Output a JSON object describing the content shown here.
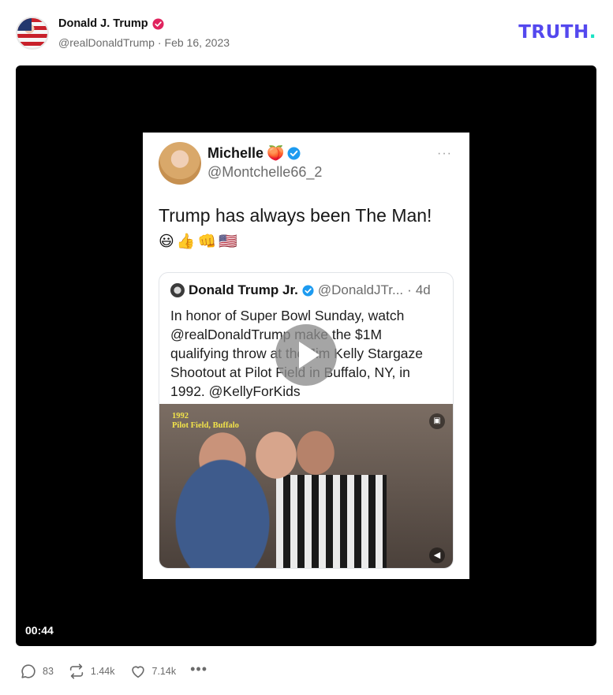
{
  "post": {
    "author_name": "Donald J. Trump",
    "handle": "@realDonaldTrump",
    "separator": "·",
    "date": "Feb 16, 2023"
  },
  "brand": {
    "wordmark": "TRUTH",
    "dot": ".",
    "colors": {
      "text": "#5448ee",
      "dot": "#17e3c4"
    }
  },
  "video": {
    "duration": "00:44",
    "embedded_tweet": {
      "author_name": "Michelle",
      "author_emoji": "🍑",
      "handle": "@Montchelle66_2",
      "more": "···",
      "text": "Trump has always been The Man!",
      "emojis": "😃👍👊🇺🇸",
      "quoted": {
        "author_name": "Donald Trump Jr.",
        "handle": "@DonaldJTr...",
        "separator": "·",
        "age": "4d",
        "text": "In honor of Super Bowl Sunday, watch @realDonaldTrump make the $1M qualifying throw at the Jim Kelly Stargaze Shootout at Pilot Field in Buffalo, NY, in 1992. @KellyForKids",
        "photo_caption_line1": "1992",
        "photo_caption_line2": "Pilot Field, Buffalo"
      }
    }
  },
  "actions": {
    "replies": "83",
    "retruths": "1.44k",
    "likes": "7.14k",
    "more": "•••"
  },
  "icons": {
    "verified": "verified-badge-icon",
    "reply": "reply-icon",
    "retruth": "retruth-icon",
    "like": "heart-icon",
    "play": "play-icon",
    "mute": "speaker-icon"
  }
}
